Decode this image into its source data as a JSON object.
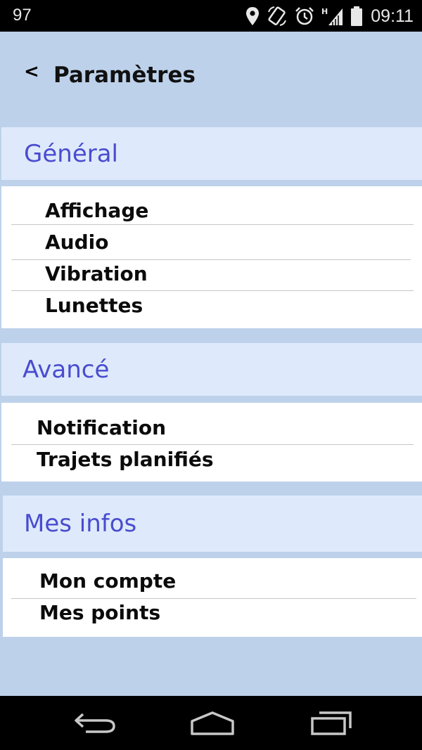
{
  "status_bar": {
    "left_text": "97",
    "time": "09:11",
    "icons": [
      "location-icon",
      "rotate-icon",
      "alarm-icon",
      "signal-h-icon",
      "battery-icon"
    ]
  },
  "header": {
    "back_label": "<",
    "title": "Paramètres"
  },
  "sections": {
    "general": {
      "title": "Général",
      "items": [
        "Affichage",
        "Audio",
        "Vibration",
        "Lunettes"
      ]
    },
    "avance": {
      "title": "Avancé",
      "items": [
        "Notification",
        "Trajets planifiés"
      ]
    },
    "mes_infos": {
      "title": "Mes infos",
      "items": [
        "Mon compte",
        "Mes points"
      ]
    }
  },
  "navigation_bar": {
    "icons": [
      "back-nav-icon",
      "home-nav-icon",
      "recents-nav-icon"
    ]
  },
  "colors": {
    "background": "#bdd1ea",
    "section_header_bg": "#deeafb",
    "section_header_text": "#4a4ccf",
    "item_text": "#0b0b0b",
    "status_bar": "#000000"
  }
}
